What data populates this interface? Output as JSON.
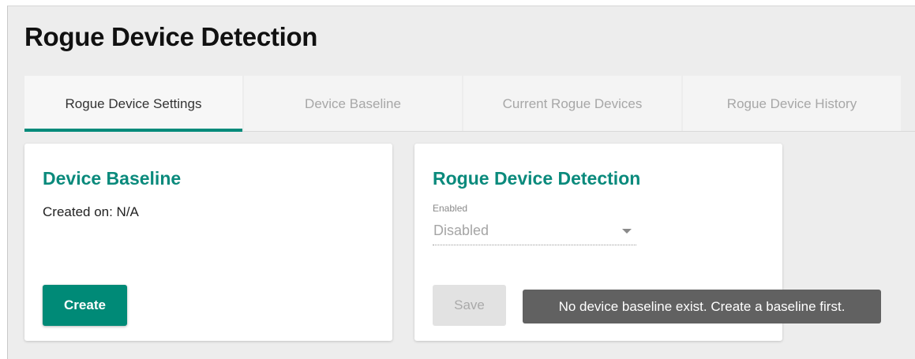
{
  "page": {
    "title": "Rogue Device Detection"
  },
  "tabs": [
    {
      "label": "Rogue Device Settings",
      "active": true
    },
    {
      "label": "Device Baseline",
      "active": false
    },
    {
      "label": "Current Rogue Devices",
      "active": false
    },
    {
      "label": "Rogue Device History",
      "active": false
    }
  ],
  "baseline_card": {
    "title": "Device Baseline",
    "created_on": "Created on: N/A",
    "create_button": "Create"
  },
  "detection_card": {
    "title": "Rogue Device Detection",
    "field_label": "Enabled",
    "field_value": "Disabled",
    "save_button": "Save"
  },
  "tooltip": {
    "text": "No device baseline exist. Create a baseline first."
  },
  "colors": {
    "accent": "#008a77",
    "title_teal": "#0a8a7c",
    "tooltip_bg": "#616161"
  }
}
